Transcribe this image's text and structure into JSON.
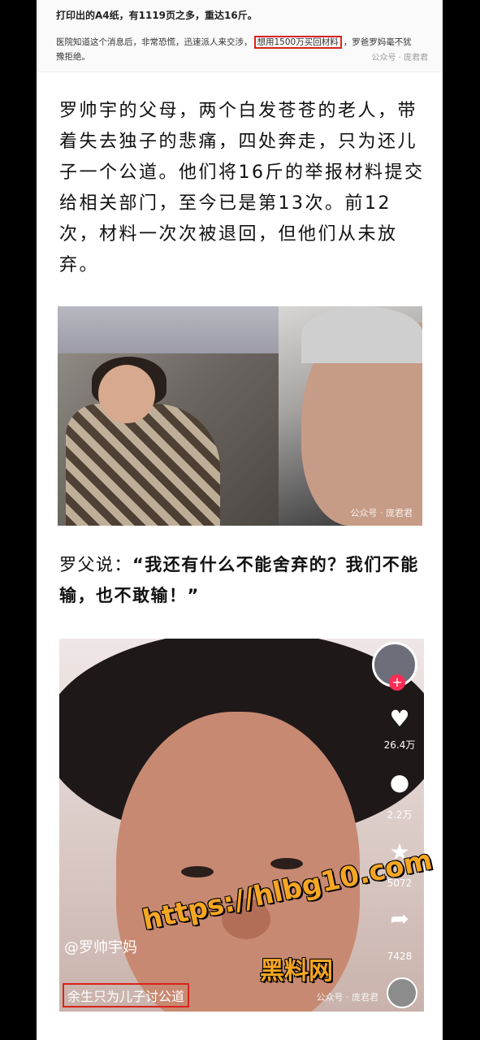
{
  "snippet": {
    "line1": "打印出的A4纸，有1119页之多，重达16斤。",
    "line2_before": "医院知道这个消息后，非常恐慌，迅速派人来交涉，",
    "line2_highlight": "想用1500万买回材料",
    "line2_after": "，罗爸罗妈毫不犹",
    "line3": "豫拒绝。",
    "watermark": "公众号 · 庞君君"
  },
  "article": {
    "paragraph": "罗帅宇的父母，两个白发苍苍的老人，带着失去独子的悲痛，四处奔走，只为还儿子一个公道。他们将16斤的举报材料提交给相关部门，至今已是第13次。前12次，材料一次次被退回，但他们从未放弃。",
    "quote_prefix": "罗父说：",
    "quote_text": "“我还有什么不能舍弃的？我们不能输，也不敢输！”"
  },
  "photo1": {
    "watermark": "公众号 · 庞君君"
  },
  "photo2": {
    "likes": "26.4万",
    "comments": "2.2万",
    "favorites": "5072",
    "shares": "7428",
    "username": "@罗帅宇妈",
    "caption": "余生只为儿子讨公道",
    "watermark": "公众号 · 庞君君"
  },
  "overlay": {
    "url": "https://hlbg10.com",
    "brand": "黑料网"
  },
  "colors": {
    "highlight_red": "#d9231d",
    "overlay_orange": "#f5a623"
  }
}
